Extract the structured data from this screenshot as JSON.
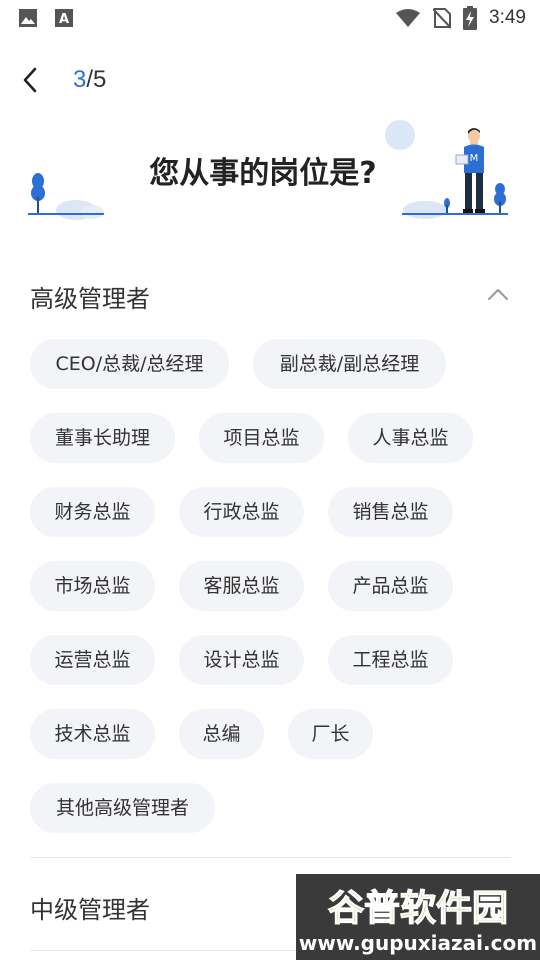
{
  "status_bar": {
    "time": "3:49",
    "left_icons": [
      "image-icon",
      "keyboard-a-icon"
    ],
    "right_icons": [
      "wifi-icon",
      "no-sim-icon",
      "battery-charging-icon"
    ]
  },
  "nav": {
    "step_current": "3",
    "step_total": "/5",
    "back_icon": "chevron-left-icon"
  },
  "hero": {
    "title": "您从事的岗位是?"
  },
  "sections": [
    {
      "title": "高级管理者",
      "expanded": true,
      "chips": [
        "CEO/总裁/总经理",
        "副总裁/副总经理",
        "董事长助理",
        "项目总监",
        "人事总监",
        "财务总监",
        "行政总监",
        "销售总监",
        "市场总监",
        "客服总监",
        "产品总监",
        "运营总监",
        "设计总监",
        "工程总监",
        "技术总监",
        "总编",
        "厂长",
        "其他高级管理者"
      ]
    },
    {
      "title": "中级管理者",
      "expanded": false
    }
  ],
  "watermark": {
    "title": "谷普软件园",
    "url": "www.gupuxiazai.com"
  },
  "colors": {
    "accent": "#2b6fd4",
    "chip_bg": "#f3f4f7",
    "text": "#333333"
  }
}
